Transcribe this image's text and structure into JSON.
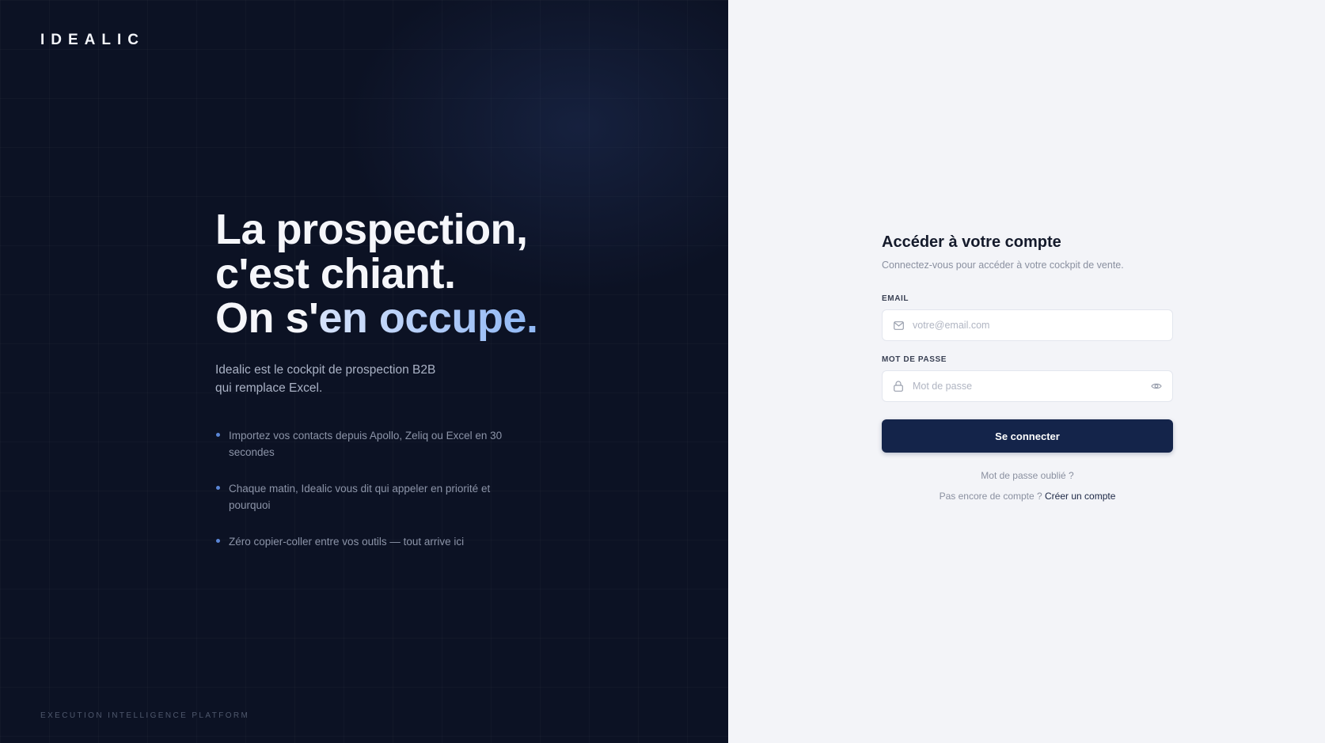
{
  "brand": {
    "logo": "IDEALIC",
    "tagline": "EXECUTION INTELLIGENCE PLATFORM"
  },
  "hero": {
    "line1": "La prospection,",
    "line2": "c'est chiant.",
    "line3_plain": "On s'",
    "line3_accent": "en occupe.",
    "subtitle_line1": "Idealic est le cockpit de prospection B2B",
    "subtitle_line2": "qui remplace Excel.",
    "bullets": [
      "Importez vos contacts depuis Apollo, Zeliq ou Excel en 30 secondes",
      "Chaque matin, Idealic vous dit qui appeler en priorité et pourquoi",
      "Zéro copier-coller entre vos outils — tout arrive ici"
    ]
  },
  "login": {
    "title": "Accéder à votre compte",
    "subtitle": "Connectez-vous pour accéder à votre cockpit de vente.",
    "email_label": "EMAIL",
    "email_placeholder": "votre@email.com",
    "email_value": "",
    "password_label": "MOT DE PASSE",
    "password_placeholder": "Mot de passe",
    "password_value": "",
    "submit_label": "Se connecter",
    "forgot_label": "Mot de passe oublié ?",
    "no_account_text": "Pas encore de compte ?",
    "create_account_label": "Créer un compte"
  },
  "colors": {
    "left_bg": "#0c1224",
    "right_bg": "#f3f4f8",
    "primary": "#14244a",
    "accent_gradient_end": "#8fb7f4",
    "bullet_dot": "#5a86d6"
  },
  "icons": {
    "email": "mail-icon",
    "password": "lock-icon",
    "toggle_password": "eye-icon"
  }
}
